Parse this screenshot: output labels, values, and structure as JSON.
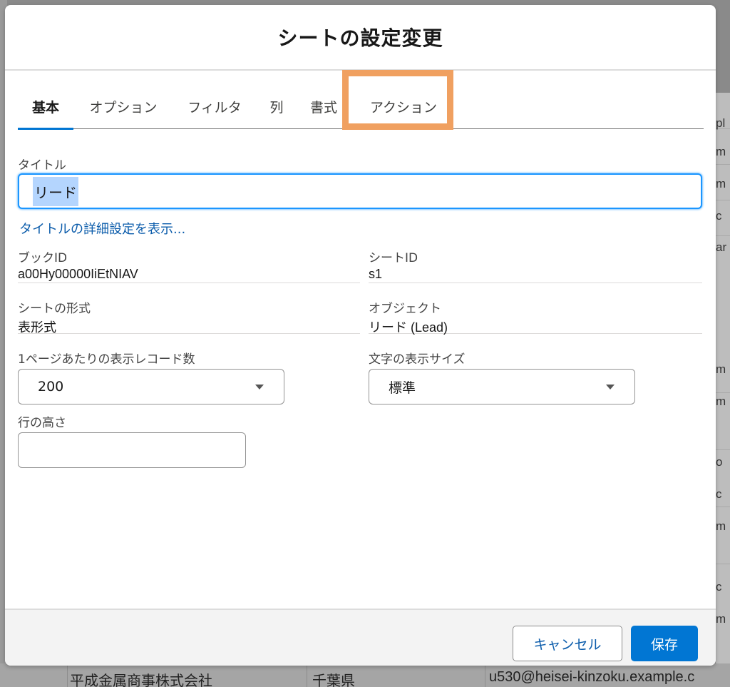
{
  "background": {
    "right_fragments": [
      "pl",
      "m",
      "m",
      "c",
      "ar",
      "m",
      "m",
      "o",
      "c",
      "m",
      "c",
      "m"
    ],
    "bottom_fragments": [
      "平成金属商事株式会社",
      "千葉県",
      "u530@heisei-kinzoku.example.c"
    ]
  },
  "modal": {
    "title": "シートの設定変更"
  },
  "tabs": [
    {
      "label": "基本",
      "active": true
    },
    {
      "label": "オプション",
      "active": false
    },
    {
      "label": "フィルタ",
      "active": false
    },
    {
      "label": "列",
      "active": false
    },
    {
      "label": "書式",
      "active": false
    },
    {
      "label": "アクション",
      "active": false
    }
  ],
  "highlight_color": "#f0a060",
  "accent_color": "#0176d3",
  "form": {
    "title_label": "タイトル",
    "title_value": "リード",
    "advanced_link": "タイトルの詳細設定を表示...",
    "book_id_label": "ブックID",
    "book_id_value": "a00Hy00000IiEtNIAV",
    "sheet_id_label": "シートID",
    "sheet_id_value": "s1",
    "sheet_format_label": "シートの形式",
    "sheet_format_value": "表形式",
    "object_label": "オブジェクト",
    "object_value": "リード (Lead)",
    "records_per_page_label": "1ページあたりの表示レコード数",
    "records_per_page_value": "200",
    "font_size_label": "文字の表示サイズ",
    "font_size_value": "標準",
    "row_height_label": "行の高さ",
    "row_height_value": ""
  },
  "footer": {
    "cancel_label": "キャンセル",
    "save_label": "保存"
  }
}
